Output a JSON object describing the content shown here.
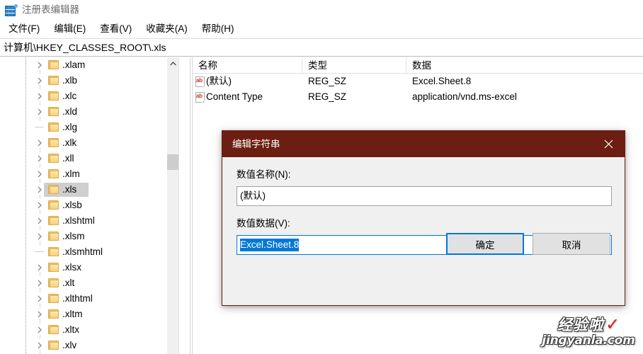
{
  "window": {
    "title": "注册表编辑器",
    "icon": "registry-editor-icon"
  },
  "menubar": {
    "items": [
      {
        "label": "文件(F)",
        "name": "menu-file"
      },
      {
        "label": "编辑(E)",
        "name": "menu-edit"
      },
      {
        "label": "查看(V)",
        "name": "menu-view"
      },
      {
        "label": "收藏夹(A)",
        "name": "menu-favorites"
      },
      {
        "label": "帮助(H)",
        "name": "menu-help"
      }
    ]
  },
  "address": {
    "path": "计算机\\HKEY_CLASSES_ROOT\\.xls"
  },
  "tree": {
    "items": [
      {
        "label": ".xlam",
        "expandable": true,
        "selected": false
      },
      {
        "label": ".xlb",
        "expandable": true,
        "selected": false
      },
      {
        "label": ".xlc",
        "expandable": true,
        "selected": false
      },
      {
        "label": ".xld",
        "expandable": true,
        "selected": false
      },
      {
        "label": ".xlg",
        "expandable": false,
        "selected": false
      },
      {
        "label": ".xlk",
        "expandable": true,
        "selected": false
      },
      {
        "label": ".xll",
        "expandable": true,
        "selected": false
      },
      {
        "label": ".xlm",
        "expandable": true,
        "selected": false
      },
      {
        "label": ".xls",
        "expandable": true,
        "selected": true
      },
      {
        "label": ".xlsb",
        "expandable": true,
        "selected": false
      },
      {
        "label": ".xlshtml",
        "expandable": true,
        "selected": false
      },
      {
        "label": ".xlsm",
        "expandable": true,
        "selected": false
      },
      {
        "label": ".xlsmhtml",
        "expandable": false,
        "selected": false
      },
      {
        "label": ".xlsx",
        "expandable": true,
        "selected": false
      },
      {
        "label": ".xlt",
        "expandable": true,
        "selected": false
      },
      {
        "label": ".xlthtml",
        "expandable": true,
        "selected": false
      },
      {
        "label": ".xltm",
        "expandable": true,
        "selected": false
      },
      {
        "label": ".xltx",
        "expandable": true,
        "selected": false
      },
      {
        "label": ".xlv",
        "expandable": true,
        "selected": false
      }
    ]
  },
  "list": {
    "columns": [
      "名称",
      "类型",
      "数据"
    ],
    "rows": [
      {
        "name": "(默认)",
        "type": "REG_SZ",
        "data": "Excel.Sheet.8",
        "icon": "string-value-icon"
      },
      {
        "name": "Content Type",
        "type": "REG_SZ",
        "data": "application/vnd.ms-excel",
        "icon": "string-value-icon"
      }
    ]
  },
  "dialog": {
    "title": "编辑字符串",
    "close_label": "✕",
    "name_label": "数值名称(N):",
    "name_value": "(默认)",
    "data_label": "数值数据(V):",
    "data_value": "Excel.Sheet.8",
    "ok_label": "确定",
    "cancel_label": "取消",
    "titlebar_color": "#6B1E11",
    "accent_color": "#0078D7"
  },
  "watermark": {
    "brand": "经验啦",
    "check": "✓",
    "url": "jingyanla.com"
  }
}
